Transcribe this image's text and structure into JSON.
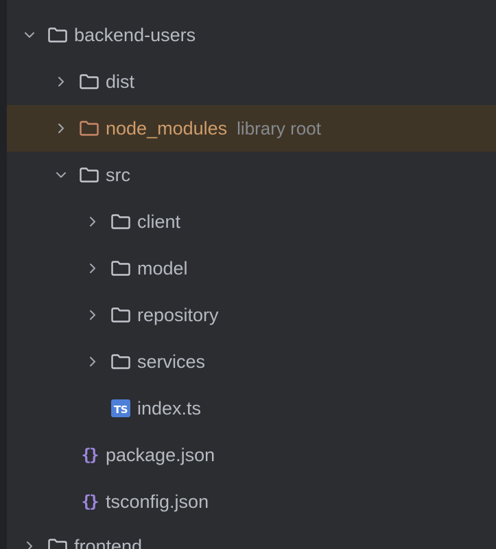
{
  "tree": {
    "items": [
      {
        "label": "backend-users",
        "hint": "",
        "icon": "folder-icon",
        "expanded": true
      },
      {
        "label": "dist",
        "hint": "",
        "icon": "folder-icon",
        "expanded": false
      },
      {
        "label": "node_modules",
        "hint": "library root",
        "icon": "folder-icon",
        "expanded": false
      },
      {
        "label": "src",
        "hint": "",
        "icon": "folder-icon",
        "expanded": true
      },
      {
        "label": "client",
        "hint": "",
        "icon": "folder-icon",
        "expanded": false
      },
      {
        "label": "model",
        "hint": "",
        "icon": "folder-icon",
        "expanded": false
      },
      {
        "label": "repository",
        "hint": "",
        "icon": "folder-icon",
        "expanded": false
      },
      {
        "label": "services",
        "hint": "",
        "icon": "folder-icon",
        "expanded": false
      },
      {
        "label": "index.ts",
        "hint": "",
        "icon": "typescript-file-icon",
        "badge": "TS"
      },
      {
        "label": "package.json",
        "hint": "",
        "icon": "json-file-icon",
        "glyph": "{}"
      },
      {
        "label": "tsconfig.json",
        "hint": "",
        "icon": "json-file-icon",
        "glyph": "{}"
      },
      {
        "label": "frontend",
        "hint": "",
        "icon": "folder-icon",
        "expanded": false
      }
    ]
  },
  "colors": {
    "background": "#2b2d30",
    "selection_highlight": "#3f3526",
    "text": "#b6bac2",
    "excluded_text": "#cf9d6b",
    "hint_text": "#868a91",
    "ts_badge": "#4e7fd8",
    "json_icon": "#9f87e0"
  }
}
